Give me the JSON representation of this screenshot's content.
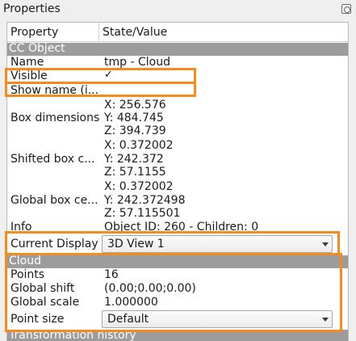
{
  "window": {
    "title": "Properties",
    "float_icon": "float-window-icon"
  },
  "table": {
    "headers": {
      "property": "Property",
      "value": "State/Value"
    },
    "sections": {
      "cc_object": "CC Object",
      "cloud": "Cloud",
      "transformation": "Transformation history"
    },
    "rows": {
      "name": {
        "label": "Name",
        "value": "tmp - Cloud"
      },
      "visible": {
        "label": "Visible",
        "checked": true,
        "check_glyph": "✓"
      },
      "show_name": {
        "label": "Show name (i...",
        "checked": false
      },
      "box_dimensions": {
        "label": "Box dimensions",
        "x": "X: 256.576",
        "y": "Y: 484.745",
        "z": "Z: 394.739"
      },
      "shifted_box": {
        "label": "Shifted box c...",
        "x": "X: 0.372002",
        "y": "Y: 242.372",
        "z": "Z: 57.1155"
      },
      "global_box": {
        "label": "Global box ce...",
        "x": "X: 0.372002",
        "y": "Y: 242.372498",
        "z": "Z: 57.115501"
      },
      "info": {
        "label": "Info",
        "value": "Object ID: 260 - Children: 0"
      },
      "current_display": {
        "label": "Current Display",
        "value": "3D View 1"
      },
      "points": {
        "label": "Points",
        "value": "16"
      },
      "global_shift": {
        "label": "Global shift",
        "value": "(0.00;0.00;0.00)"
      },
      "global_scale": {
        "label": "Global scale",
        "value": "1.000000"
      },
      "point_size": {
        "label": "Point size",
        "value": "Default"
      }
    }
  },
  "highlight_color": "#f58b1f",
  "section_color": "#9c9c9c"
}
